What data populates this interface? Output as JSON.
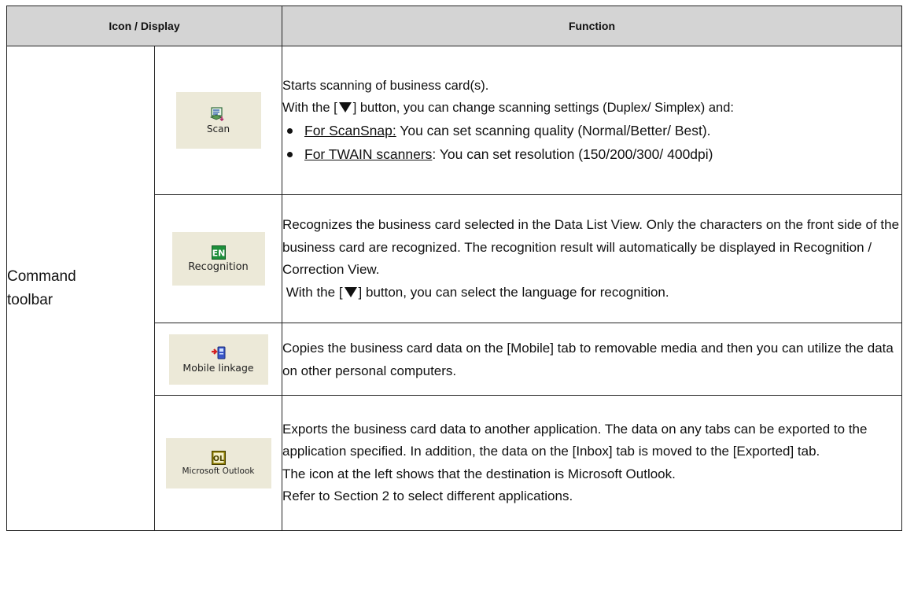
{
  "header": {
    "col1": "Icon / Display",
    "col2": "Function"
  },
  "group_label": "Command toolbar",
  "rows": [
    {
      "icon_label": "Scan",
      "icon": "scan-icon",
      "lines": [
        "Starts scanning of business card(s).",
        "] button, you can change scanning settings (Duplex/ Simplex) and:"
      ],
      "with_the": "With the [",
      "bullets": [
        {
          "lead": "For ScanSnap:",
          "text": " You can set scanning quality (Normal/Better/ Best)."
        },
        {
          "lead": "For TWAIN scanners",
          "text": ": You can set resolution (150/200/300/ 400dpi)"
        }
      ]
    },
    {
      "icon_label": "Recognition",
      "icon": "recognition-en-icon",
      "text": "Recognizes the business card selected in the Data List View. Only the characters on the front side of the business card are recognized. The recognition result will automatically be displayed in Recognition / Correction View.",
      "with_the": "With the [",
      "tail": "] button, you can select the language for recognition."
    },
    {
      "icon_label": "Mobile linkage",
      "icon": "mobile-linkage-icon",
      "text": "Copies the business card data on the [Mobile] tab to removable media and then you can utilize the data on other personal computers."
    },
    {
      "icon_label": "Microsoft Outlook",
      "icon": "outlook-ol-icon",
      "text": "Exports the business card data to another application. The data on any tabs can be exported to the application specified. In addition, the data on the [Inbox] tab is moved to the [Exported] tab.",
      "text2": "The icon at the left shows that the destination is Microsoft Outlook.",
      "text3": "Refer to Section 2 to select different applications."
    }
  ]
}
